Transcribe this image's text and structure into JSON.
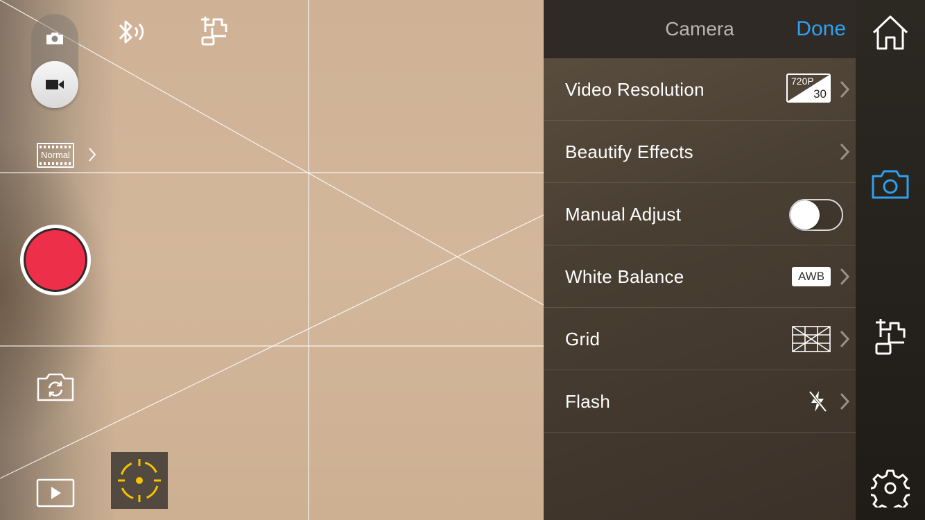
{
  "colors": {
    "accent": "#2fa0f0",
    "record": "#ed2f4a",
    "focus": "#f5c400"
  },
  "left_toolbar": {
    "capture_modes": [
      "photo",
      "video"
    ],
    "selected_mode": "video",
    "filter_label": "Normal",
    "icons": [
      "camera-icon",
      "video-camera-icon",
      "bluetooth-icon",
      "gimbal-icon",
      "film-icon",
      "chevron-right-icon",
      "record-icon",
      "switch-camera-icon",
      "play-icon",
      "focus-target-icon"
    ]
  },
  "panel": {
    "title": "Camera",
    "done_label": "Done",
    "rows": [
      {
        "label": "Video Resolution",
        "value_top": "720P",
        "value_bottom": "30"
      },
      {
        "label": "Beautify Effects"
      },
      {
        "label": "Manual Adjust",
        "toggle_on": false
      },
      {
        "label": "White Balance",
        "value": "AWB"
      },
      {
        "label": "Grid"
      },
      {
        "label": "Flash",
        "flash_mode": "off"
      }
    ]
  },
  "right_rail": {
    "items": [
      "home-icon",
      "camera-icon",
      "gimbal-icon",
      "gear-icon"
    ],
    "selected": "camera-icon"
  }
}
